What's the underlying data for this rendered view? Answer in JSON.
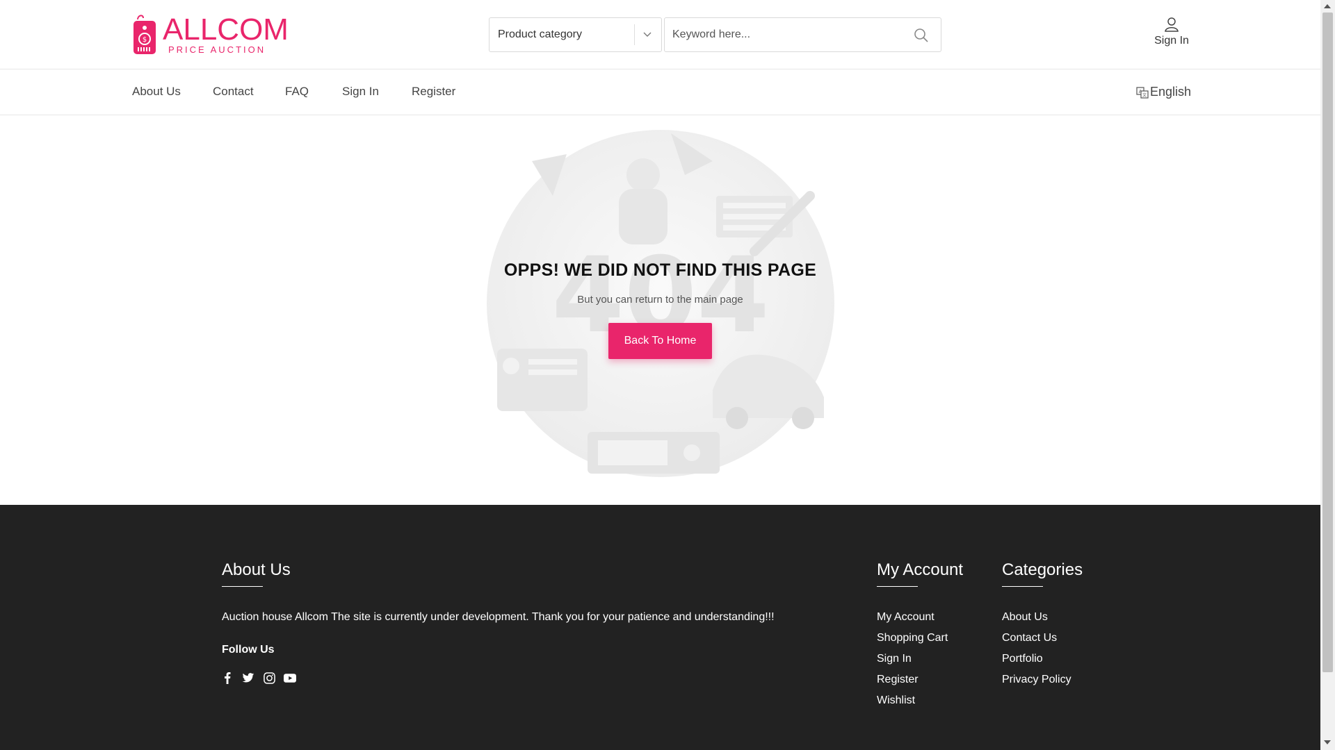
{
  "brand": {
    "name": "ALLCOM",
    "tagline": "PRICE AUCTION",
    "accent_color": "#e9256b"
  },
  "search": {
    "category_label": "Product category",
    "keyword_placeholder": "Keyword here..."
  },
  "header": {
    "signin_label": "Sign In"
  },
  "nav": {
    "items": [
      "About Us",
      "Contact",
      "FAQ",
      "Sign In",
      "Register"
    ],
    "language": "English"
  },
  "error": {
    "title": "OPPS! WE DID NOT FIND THIS PAGE",
    "subtitle": "But you can return to the main page",
    "button": "Back To Home"
  },
  "footer": {
    "about": {
      "heading": "About Us",
      "text": "Auction house Allcom The site is currently under development. Thank you for your patience and understanding!!!",
      "follow": "Follow Us",
      "socials": [
        "facebook-icon",
        "twitter-icon",
        "instagram-icon",
        "youtube-icon"
      ]
    },
    "account": {
      "heading": "My Account",
      "items": [
        "My Account",
        "Shopping Cart",
        "Sign In",
        "Register",
        "Wishlist"
      ]
    },
    "categories": {
      "heading": "Categories",
      "items": [
        "About Us",
        "Contact Us",
        "Portfolio",
        "Privacy Policy"
      ]
    },
    "background": "#222222"
  }
}
